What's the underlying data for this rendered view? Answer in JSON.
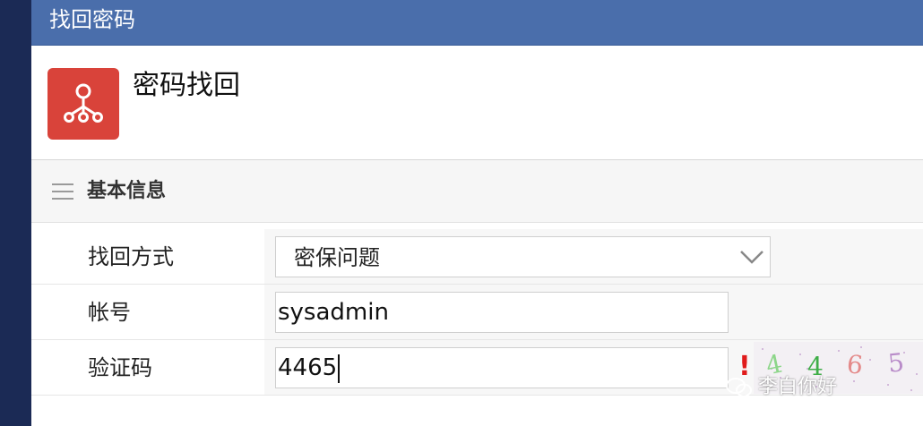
{
  "window": {
    "title": "找回密码"
  },
  "header": {
    "heading": "密码找回",
    "icon": "org-chart-icon"
  },
  "section": {
    "title": "基本信息",
    "icon": "list-icon"
  },
  "form": {
    "method": {
      "label": "找回方式",
      "value": "密保问题",
      "icon": "chevron-down-icon"
    },
    "account": {
      "label": "帐号",
      "value": "sysadmin"
    },
    "captcha": {
      "label": "验证码",
      "value": "4465",
      "warning": "!",
      "image_chars": [
        "4",
        "4",
        "6",
        "5"
      ]
    }
  },
  "watermark": {
    "text": "李白你好",
    "icon": "wechat-icon"
  },
  "colors": {
    "titlebar": "#4a6eab",
    "rail": "#1b2a55",
    "app_icon": "#d9433a",
    "warning": "#e01b1b"
  }
}
